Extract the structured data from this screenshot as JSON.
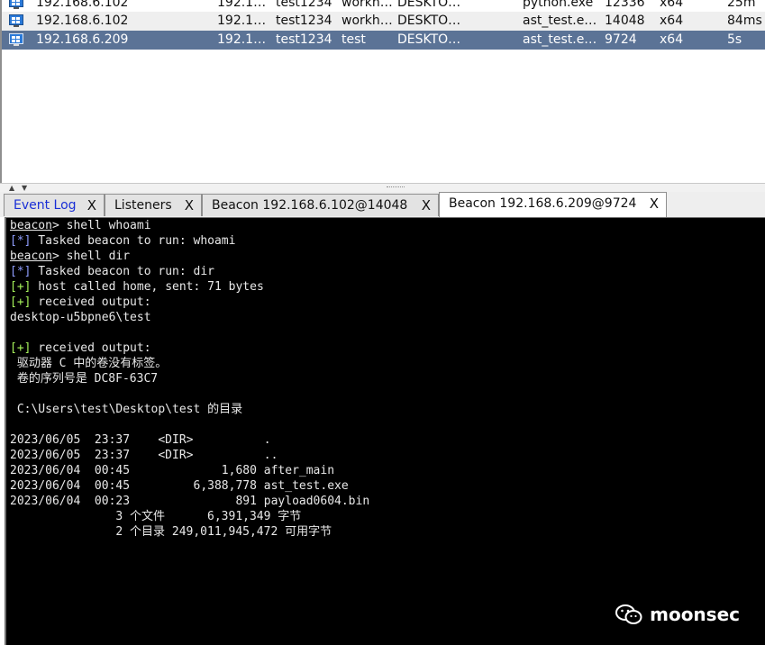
{
  "sessions": [
    {
      "external": "192.168.6.102",
      "internal": "192.1…",
      "listener": "test1234",
      "user": "workh…",
      "computer": "DESKTO…",
      "process": "python.exe",
      "pid": "12336",
      "arch": "x64",
      "last": "25m",
      "style": "plain"
    },
    {
      "external": "192.168.6.102",
      "internal": "192.1…",
      "listener": "test1234",
      "user": "workh…",
      "computer": "DESKTO…",
      "process": "ast_test.e…",
      "pid": "14048",
      "arch": "x64",
      "last": "84ms",
      "style": "alt"
    },
    {
      "external": "192.168.6.209",
      "internal": "192.1…",
      "listener": "test1234",
      "user": "test",
      "computer": "DESKTO…",
      "process": "ast_test.e…",
      "pid": "9724",
      "arch": "x64",
      "last": "5s",
      "style": "sel"
    }
  ],
  "tabs": [
    {
      "label": "Event Log",
      "close": "X"
    },
    {
      "label": "Listeners",
      "close": "X"
    },
    {
      "label": "Beacon 192.168.6.102@14048",
      "close": "X"
    },
    {
      "label": "Beacon 192.168.6.209@9724",
      "close": "X"
    }
  ],
  "console": {
    "prompt": "beacon",
    "cmd1": "> shell whoami",
    "tag_info": "[*]",
    "tag_ok": "[+]",
    "tasked1": " Tasked beacon to run: whoami",
    "cmd2": "> shell dir",
    "tasked2": " Tasked beacon to run: dir",
    "host_called": " host called home, sent: 71 bytes",
    "received": " received output:",
    "whoami_out": "desktop-u5bpne6\\test",
    "dir_lines": [
      " 驱动器 C 中的卷没有标签。",
      " 卷的序列号是 DC8F-63C7",
      "",
      " C:\\Users\\test\\Desktop\\test 的目录",
      "",
      "2023/06/05  23:37    <DIR>          .",
      "2023/06/05  23:37    <DIR>          ..",
      "2023/06/04  00:45             1,680 after_main",
      "2023/06/04  00:45         6,388,778 ast_test.exe",
      "2023/06/04  00:23               891 payload0604.bin",
      "               3 个文件      6,391,349 字节",
      "               2 个目录 249,011,945,472 可用字节"
    ]
  },
  "watermark": "moonsec"
}
